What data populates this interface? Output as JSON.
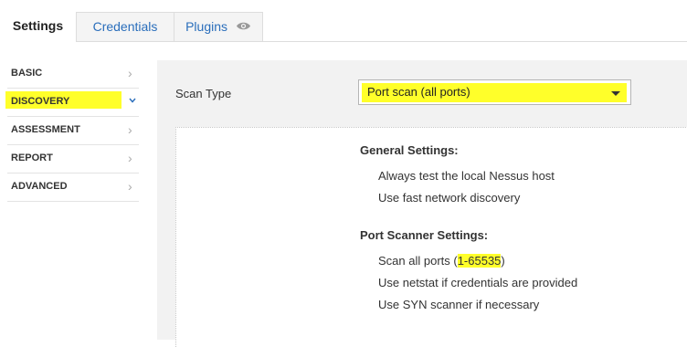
{
  "tabs": [
    {
      "label": "Settings"
    },
    {
      "label": "Credentials"
    },
    {
      "label": "Plugins"
    }
  ],
  "sidebar": {
    "items": [
      {
        "label": "BASIC"
      },
      {
        "label": "DISCOVERY"
      },
      {
        "label": "ASSESSMENT"
      },
      {
        "label": "REPORT"
      },
      {
        "label": "ADVANCED"
      }
    ]
  },
  "main": {
    "scan_type_label": "Scan Type",
    "scan_type_value": "Port scan (all ports)",
    "sections": {
      "general_title": "General Settings:",
      "general_opt1": "Always test the local Nessus host",
      "general_opt2": "Use fast network discovery",
      "port_title": "Port Scanner Settings:",
      "port_opt1_prefix": "Scan all ports (",
      "port_opt1_range": "1-65535",
      "port_opt1_suffix": ")",
      "port_opt2": "Use netstat if credentials are provided",
      "port_opt3": "Use SYN scanner if necessary"
    }
  },
  "colors": {
    "highlight": "#ffff2a",
    "link": "#2a6ebb"
  },
  "icons": {
    "plugins_tab": "eye-icon",
    "sidebar_collapsed": "chevron-right-icon",
    "sidebar_expanded": "chevron-down-icon",
    "select": "caret-down-icon"
  }
}
